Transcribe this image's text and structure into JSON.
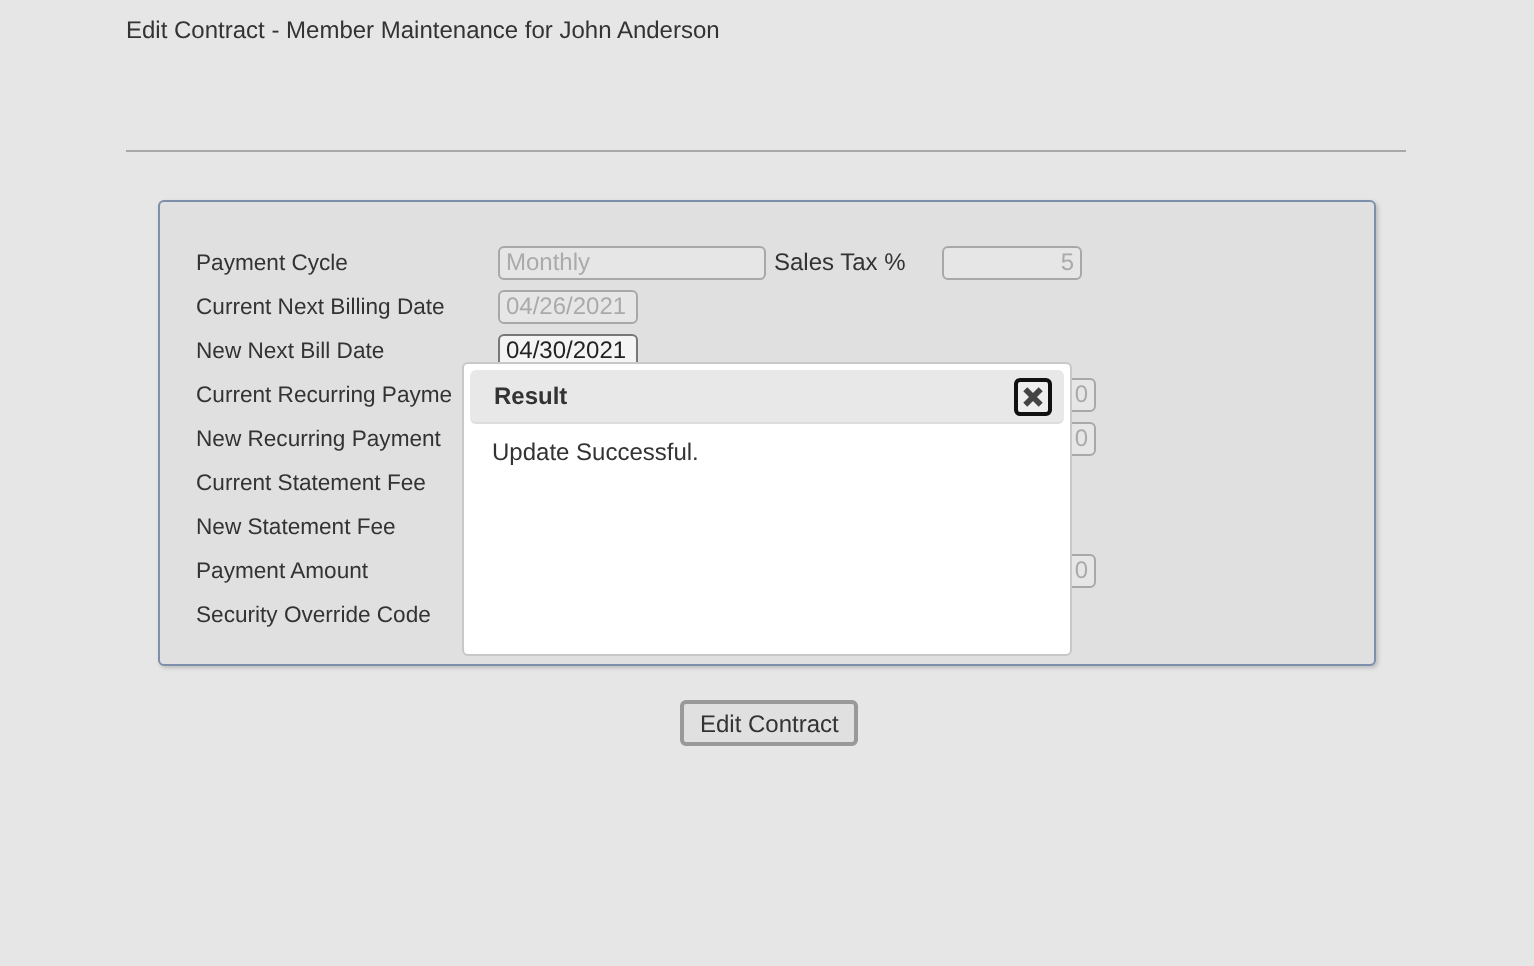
{
  "page_title": "Edit Contract - Member Maintenance for John Anderson",
  "form_rows": [
    {
      "label": "Payment Cycle",
      "field": {
        "value": "Monthly",
        "disabled": true,
        "kind": "wide"
      },
      "extra": {
        "label": "Sales Tax %",
        "value": "5",
        "disabled": true
      }
    },
    {
      "label": "Current Next Billing Date",
      "field": {
        "value": "04/26/2021",
        "disabled": true,
        "kind": "date"
      }
    },
    {
      "label": "New Next Bill Date",
      "field": {
        "value": "04/30/2021",
        "disabled": false,
        "kind": "date"
      }
    },
    {
      "label": "Current Recurring Payme",
      "field": {
        "value": "0",
        "disabled": true,
        "kind": "long"
      }
    },
    {
      "label": "New Recurring Payment",
      "field": {
        "value": "0",
        "disabled": true,
        "kind": "long"
      }
    },
    {
      "label": "Current Statement Fee"
    },
    {
      "label": "New Statement Fee"
    },
    {
      "label": "Payment Amount",
      "field": {
        "value": "0",
        "disabled": true,
        "kind": "long"
      }
    },
    {
      "label": "Security Override Code"
    }
  ],
  "dialog": {
    "title": "Result",
    "message": "Update Successful."
  },
  "button": "Edit Contract"
}
